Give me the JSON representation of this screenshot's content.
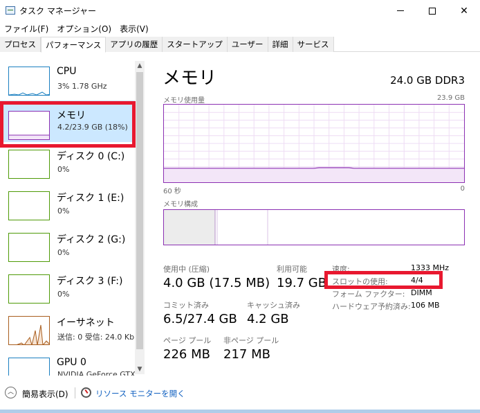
{
  "window": {
    "title": "タスク マネージャー",
    "controls": [
      "minimize",
      "maximize",
      "close"
    ]
  },
  "menu": [
    "ファイル(F)",
    "オプション(O)",
    "表示(V)"
  ],
  "tabs": [
    {
      "label": "プロセス",
      "active": false
    },
    {
      "label": "パフォーマンス",
      "active": true
    },
    {
      "label": "アプリの履歴",
      "active": false
    },
    {
      "label": "スタートアップ",
      "active": false
    },
    {
      "label": "ユーザー",
      "active": false
    },
    {
      "label": "詳細",
      "active": false
    },
    {
      "label": "サービス",
      "active": false
    }
  ],
  "sidebar": {
    "items": [
      {
        "name": "CPU",
        "sub": "3%  1.78 GHz",
        "kind": "cpu",
        "selected": false
      },
      {
        "name": "メモリ",
        "sub": "4.2/23.9 GB (18%)",
        "kind": "mem",
        "selected": true
      },
      {
        "name": "ディスク 0 (C:)",
        "sub": "0%",
        "kind": "disk",
        "selected": false
      },
      {
        "name": "ディスク 1 (E:)",
        "sub": "0%",
        "kind": "disk",
        "selected": false
      },
      {
        "name": "ディスク 2 (G:)",
        "sub": "0%",
        "kind": "disk",
        "selected": false
      },
      {
        "name": "ディスク 3 (F:)",
        "sub": "0%",
        "kind": "disk",
        "selected": false
      },
      {
        "name": "イーサネット",
        "sub": "送信: 0 受信: 24.0 Kb",
        "kind": "eth",
        "selected": false
      },
      {
        "name": "GPU 0",
        "sub": "NVIDIA GeForce GTX",
        "kind": "gpu",
        "selected": false
      }
    ]
  },
  "main": {
    "title": "メモリ",
    "spec": "24.0 GB DDR3",
    "usage_chart": {
      "label": "メモリ使用量",
      "max_label": "23.9 GB",
      "time_label": "60 秒",
      "zero_label": "0",
      "used_fraction": 0.18,
      "line_color": "#8b2fb2"
    },
    "composition_chart": {
      "label": "メモリ構成"
    },
    "stats": {
      "in_use_label": "使用中 (圧縮)",
      "in_use_value": "4.0 GB (17.5 MB)",
      "available_label": "利用可能",
      "available_value": "19.7 GB",
      "committed_label": "コミット済み",
      "committed_value": "6.5/27.4 GB",
      "cached_label": "キャッシュ済み",
      "cached_value": "4.2 GB",
      "paged_label": "ページ プール",
      "paged_value": "226 MB",
      "nonpaged_label": "非ページ プール",
      "nonpaged_value": "217 MB"
    },
    "details": [
      {
        "label": "速度:",
        "value": "1333 MHz"
      },
      {
        "label": "スロットの使用:",
        "value": "4/4"
      },
      {
        "label": "フォーム ファクター:",
        "value": "DIMM"
      },
      {
        "label": "ハードウェア予約済み:",
        "value": "106 MB"
      }
    ]
  },
  "footer": {
    "fewer_details": "簡易表示(D)",
    "resource_monitor": "リソース モニターを開く"
  },
  "colors": {
    "highlight": "#e8182f",
    "memory": "#8b2fb2",
    "selected_bg": "#cce8ff"
  }
}
